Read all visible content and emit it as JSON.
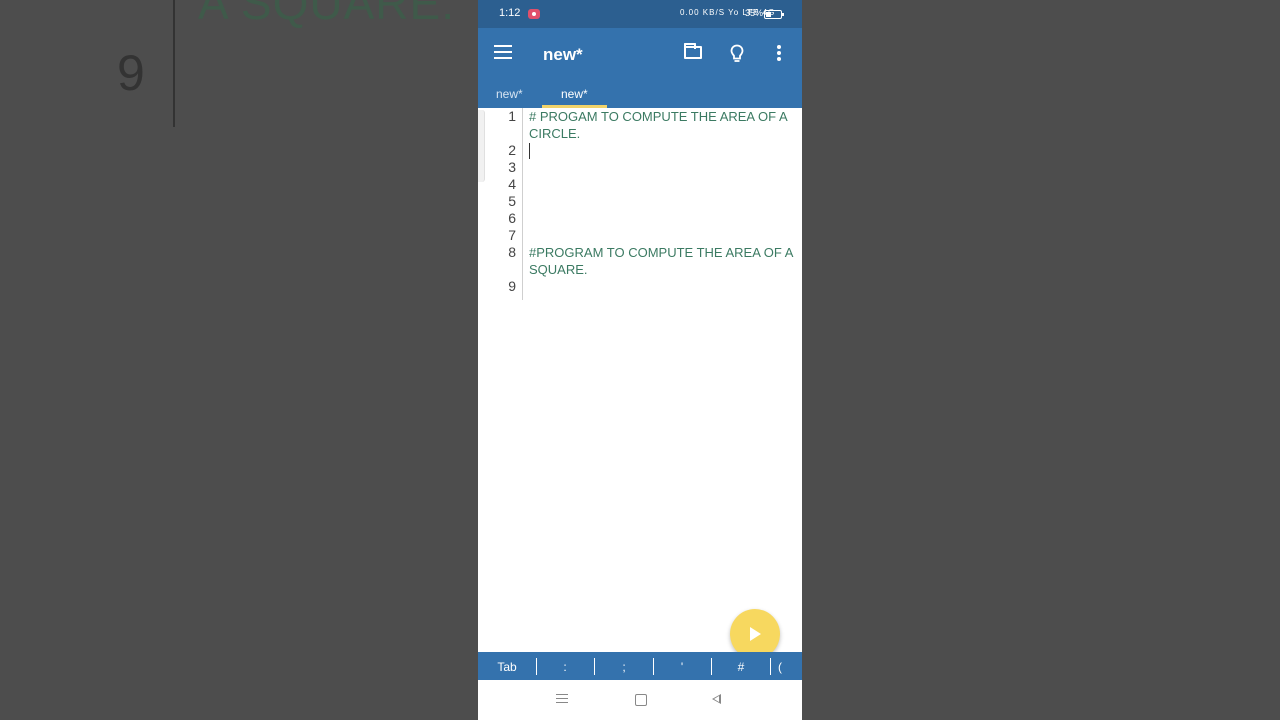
{
  "background": {
    "zoom_text": "A SQUARE.",
    "zoom_line_number": "9"
  },
  "status_bar": {
    "time": "1:12",
    "signal_text": "0.00 KB/S  Yo LTE  4G",
    "battery": "35%"
  },
  "app_bar": {
    "title": "new*",
    "icons": [
      "menu-icon",
      "folder-icon",
      "lightbulb-icon",
      "more-vert-icon"
    ]
  },
  "tabs": [
    {
      "label": "new*",
      "active": false
    },
    {
      "label": "new*",
      "active": true
    }
  ],
  "editor": {
    "line_numbers": [
      "1",
      "2",
      "3",
      "4",
      "5",
      "6",
      "7",
      "8",
      "9"
    ],
    "lines": {
      "line1": "# PROGAM TO COMPUTE THE AREA OF A CIRCLE.",
      "line8": "#PROGRAM TO COMPUTE THE AREA OF A SQUARE."
    }
  },
  "keybar": [
    "Tab",
    ":",
    ";",
    "'",
    "#",
    "("
  ],
  "colors": {
    "status_bar": "#2c5f90",
    "app_bar": "#3472ad",
    "tab_indicator": "#f1d36a",
    "fab": "#f7d85f",
    "comment_text": "#3b7a62"
  }
}
